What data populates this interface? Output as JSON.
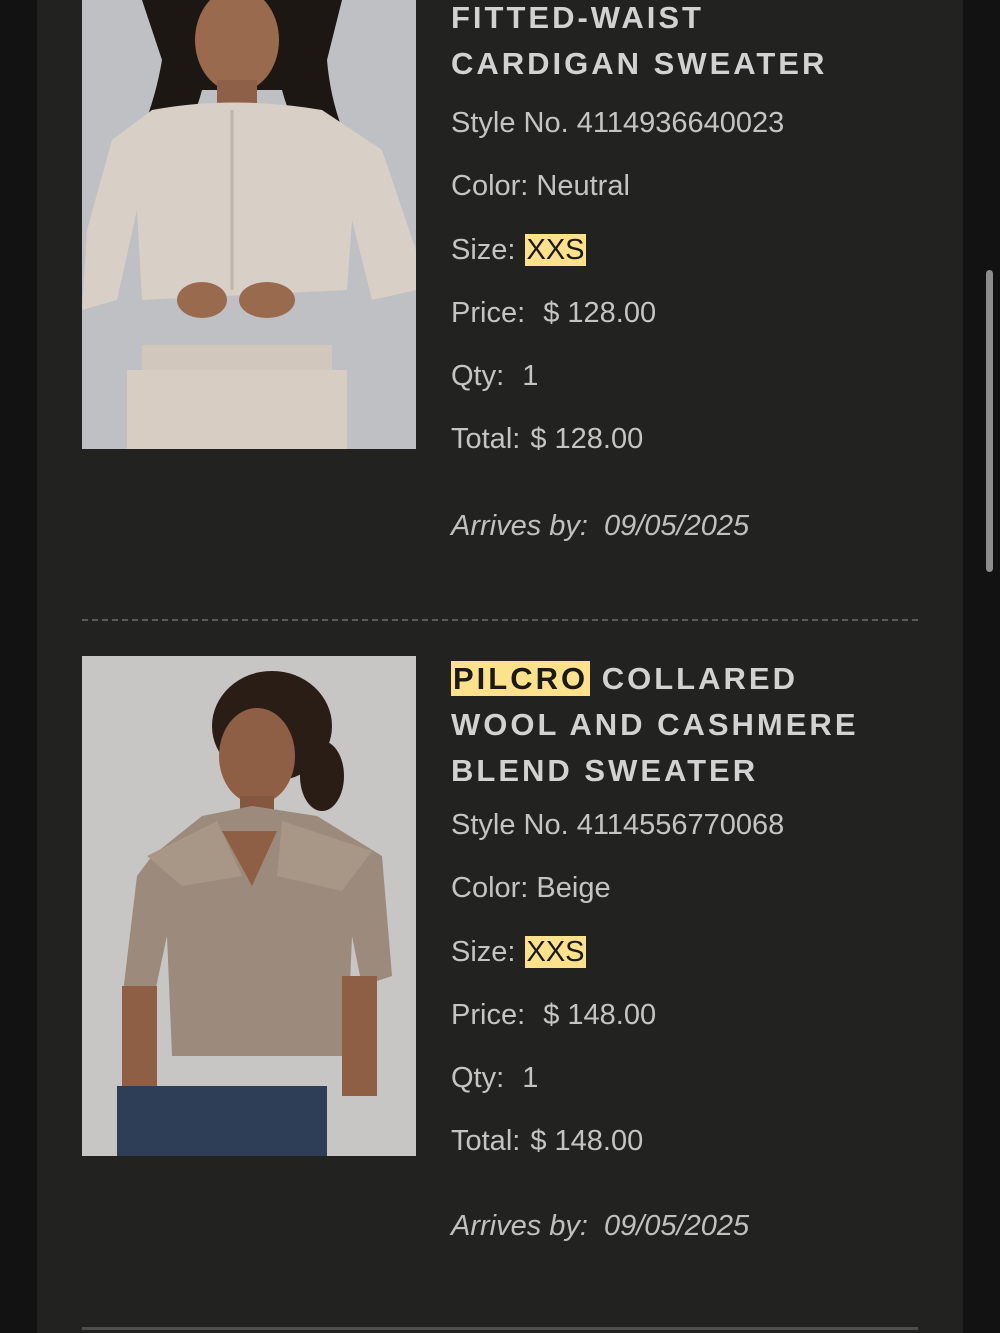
{
  "items": [
    {
      "title_lines": [
        "FITTED-WAIST",
        "CARDIGAN SWEATER"
      ],
      "style_label": "Style No.",
      "style_no": "4114936640023",
      "color_label": "Color:",
      "color": "Neutral",
      "size_label": "Size:",
      "size": "XXS",
      "price_label": "Price:",
      "price": "$ 128.00",
      "qty_label": "Qty:",
      "qty": "1",
      "total_label": "Total:",
      "total": "$ 128.00",
      "arrives_label": "Arrives by:",
      "arrives": "09/05/2025",
      "image_alt_icon": "product-photo-cardigan"
    },
    {
      "brand": "PILCRO",
      "title_line1_rest": "COLLARED",
      "title_lines": [
        "WOOL AND CASHMERE",
        "BLEND SWEATER"
      ],
      "style_label": "Style No.",
      "style_no": "4114556770068",
      "color_label": "Color:",
      "color": "Beige",
      "size_label": "Size:",
      "size": "XXS",
      "price_label": "Price:",
      "price": "$ 148.00",
      "qty_label": "Qty:",
      "qty": "1",
      "total_label": "Total:",
      "total": "$ 148.00",
      "arrives_label": "Arrives by:",
      "arrives": "09/05/2025",
      "image_alt_icon": "product-photo-polo-sweater"
    }
  ],
  "colors": {
    "background": "#121212",
    "panel": "#222221",
    "highlight": "#fde28b",
    "text": "#c4c4c4"
  }
}
